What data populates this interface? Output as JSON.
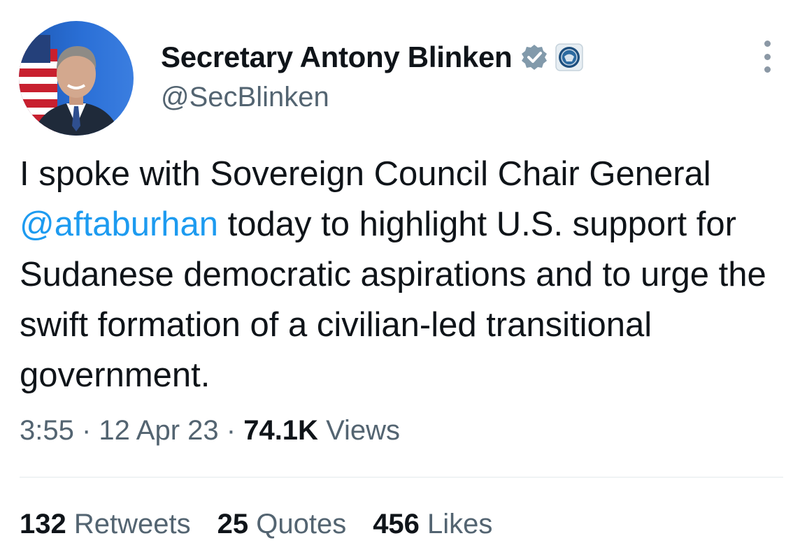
{
  "author": {
    "display_name": "Secretary Antony Blinken",
    "handle": "@SecBlinken",
    "avatar_icon": "avatar-portrait",
    "verified_icon": "verified-badge-icon",
    "affiliation_icon": "state-department-seal-icon",
    "verified_color": "#829aab"
  },
  "tweet": {
    "segments": {
      "s1": "I spoke with Sovereign Council Chair General ",
      "mention": "@aftaburhan",
      "s2": " today to highlight U.S. support for Sudanese democratic aspirations and to urge the swift formation of a civilian-led transitional government."
    }
  },
  "meta": {
    "time": "3:55",
    "sep1": " · ",
    "date": "12 Apr 23",
    "sep2": " · ",
    "views_count": "74.1K",
    "views_label": " Views"
  },
  "stats": {
    "retweets": {
      "count": "132",
      "label": " Retweets"
    },
    "quotes": {
      "count": "25",
      "label": " Quotes"
    },
    "likes": {
      "count": "456",
      "label": " Likes"
    }
  },
  "colors": {
    "link": "#1d9bf0",
    "secondary_text": "#536471",
    "primary_text": "#0f1419"
  }
}
